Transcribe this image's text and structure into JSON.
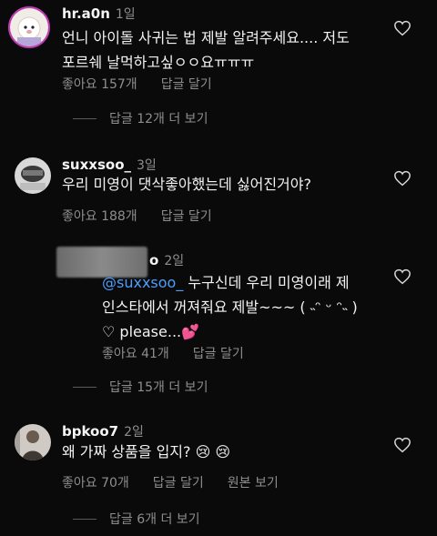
{
  "comments": [
    {
      "username": "hr.a0n",
      "time": "1일",
      "text_line1": "언니 아이돌 사귀는 법 제발 알려주세요.... 저도",
      "text_line2": "포르쉐 날먹하고싶ㅇㅇ요ㅠㅠㅠ",
      "likes": "좋아요 157개",
      "reply": "답글 달기",
      "view_replies": "답글 12개 더 보기"
    },
    {
      "username": "suxxsoo_",
      "time": "3일",
      "text": "우리 미영이 댓삭좋아했는데 싫어진거야?",
      "likes": "좋아요 188개",
      "reply": "답글 달기",
      "reply_comment": {
        "username_suffix": "o",
        "time": "2일",
        "mention": "@suxxsoo_",
        "text_line1": " 누구신데 우리 미영이래  제",
        "text_line2": "인스타에서 꺼져줘요 제발~~~ ( ˵ᵔ ᵕ ᵔ˵ )",
        "text_line3": "♡  please...💕",
        "likes": "좋아요 41개",
        "reply": "답글 달기"
      },
      "view_replies": "답글 15개 더 보기"
    },
    {
      "username": "bpkoo7",
      "time": "2일",
      "text": "왜 가짜 상품을 입지? 😢 😢",
      "likes": "좋아요 70개",
      "reply": "답글 달기",
      "see_original": "원본 보기",
      "view_replies": "답글 6개 더 보기"
    }
  ],
  "colors": {
    "background": "#0a0a0a",
    "secondary_text": "#8e8e8e",
    "mention": "#4d9dff",
    "avatar_ring": "#c33bb5"
  },
  "icons": [
    "heart-outline-icon"
  ]
}
